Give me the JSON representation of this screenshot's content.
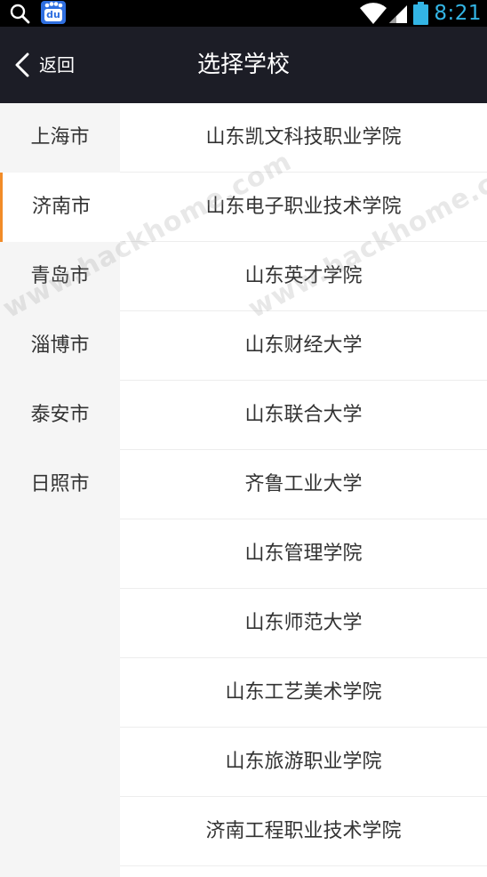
{
  "status_bar": {
    "time": "8:21",
    "icons": [
      "search-icon",
      "baidu-icon",
      "wifi-icon",
      "signal-icon",
      "battery-icon"
    ],
    "baidu_text": "du",
    "time_color": "#33b5e5"
  },
  "header": {
    "back_label": "返回",
    "title": "选择学校",
    "background": "#1c1d26"
  },
  "sidebar": {
    "active_index": 1,
    "accent_color": "#f28c28",
    "items": [
      {
        "label": "上海市"
      },
      {
        "label": "济南市"
      },
      {
        "label": "青岛市"
      },
      {
        "label": "淄博市"
      },
      {
        "label": "泰安市"
      },
      {
        "label": "日照市"
      }
    ]
  },
  "schools": {
    "items": [
      {
        "label": "山东凯文科技职业学院"
      },
      {
        "label": "山东电子职业技术学院"
      },
      {
        "label": "山东英才学院"
      },
      {
        "label": "山东财经大学"
      },
      {
        "label": "山东联合大学"
      },
      {
        "label": "齐鲁工业大学"
      },
      {
        "label": "山东管理学院"
      },
      {
        "label": "山东师范大学"
      },
      {
        "label": "山东工艺美术学院"
      },
      {
        "label": "山东旅游职业学院"
      },
      {
        "label": "济南工程职业技术学院"
      }
    ]
  },
  "watermark": {
    "text": "www.hackhome.com"
  }
}
